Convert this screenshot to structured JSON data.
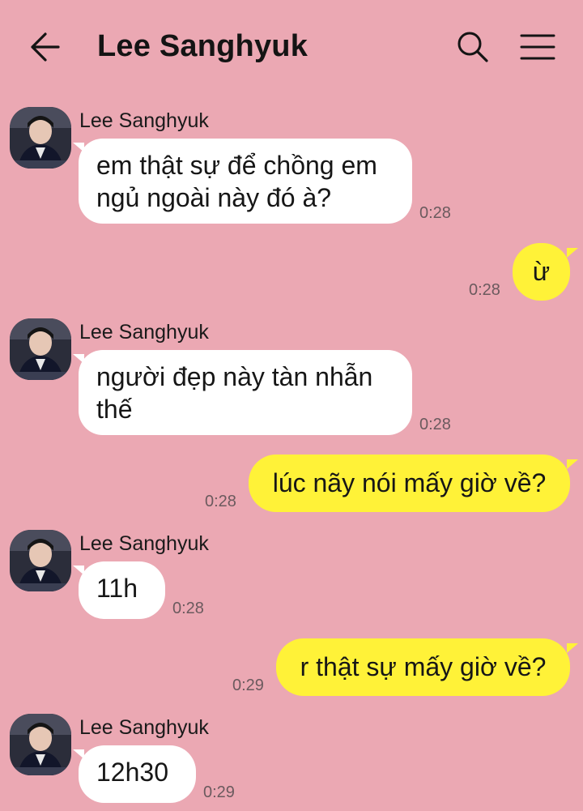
{
  "header": {
    "back_icon": "arrow-left-icon",
    "title": "Lee Sanghyuk",
    "search_icon": "search-icon",
    "menu_icon": "hamburger-menu-icon"
  },
  "colors": {
    "background": "#eba8b3",
    "incoming_bubble": "#ffffff",
    "outgoing_bubble": "#fff238"
  },
  "messages": [
    {
      "direction": "incoming",
      "sender": "Lee Sanghyuk",
      "lines": [
        "em thật sự để chồng em",
        "ngủ ngoài này đó à?"
      ],
      "time": "0:28"
    },
    {
      "direction": "outgoing",
      "lines": [
        "ừ"
      ],
      "time": "0:28"
    },
    {
      "direction": "incoming",
      "sender": "Lee Sanghyuk",
      "lines": [
        "người đẹp này tàn nhẫn",
        "thế"
      ],
      "time": "0:28"
    },
    {
      "direction": "outgoing",
      "lines": [
        "lúc nãy nói mấy giờ về?"
      ],
      "time": "0:28"
    },
    {
      "direction": "incoming",
      "sender": "Lee Sanghyuk",
      "lines": [
        "11h"
      ],
      "time": "0:28"
    },
    {
      "direction": "outgoing",
      "lines": [
        "r thật sự mấy giờ về?"
      ],
      "time": "0:29"
    },
    {
      "direction": "incoming",
      "sender": "Lee Sanghyuk",
      "lines": [
        "12h30"
      ],
      "time": "0:29"
    }
  ]
}
